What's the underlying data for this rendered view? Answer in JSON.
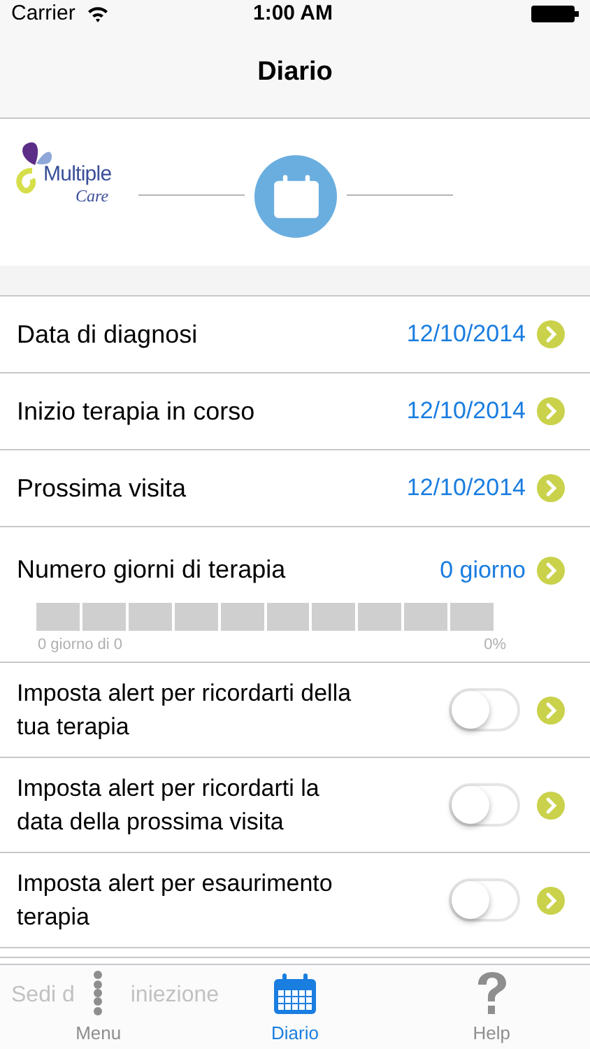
{
  "status_bar": {
    "carrier": "Carrier",
    "time": "1:00 AM"
  },
  "nav_bar": {
    "title": "Diario"
  },
  "header": {
    "logo_line1": "Multiple",
    "logo_line2": "Care"
  },
  "date_rows": [
    {
      "label": "Data di diagnosi",
      "value": "12/10/2014"
    },
    {
      "label": "Inizio terapia in corso",
      "value": "12/10/2014"
    },
    {
      "label": "Prossima visita",
      "value": "12/10/2014"
    }
  ],
  "therapy_days": {
    "label": "Numero giorni di terapia",
    "value": "0 giorno",
    "caption": "0 giorno di 0",
    "percent": "0%"
  },
  "alert_rows": [
    {
      "label": "Imposta alert per ricordarti della tua terapia",
      "on": false
    },
    {
      "label": "Imposta alert per ricordarti la data della prossima visita",
      "on": false
    },
    {
      "label": "Imposta alert per esaurimento terapia",
      "on": false
    }
  ],
  "hidden_row": {
    "label_start": "Sedi d",
    "label_end": "iniezione"
  },
  "tab_bar": [
    {
      "label": "Menu",
      "kind": "menu",
      "selected": false
    },
    {
      "label": "Diario",
      "kind": "diary",
      "selected": true
    },
    {
      "label": "Help",
      "kind": "help",
      "selected": false
    }
  ]
}
